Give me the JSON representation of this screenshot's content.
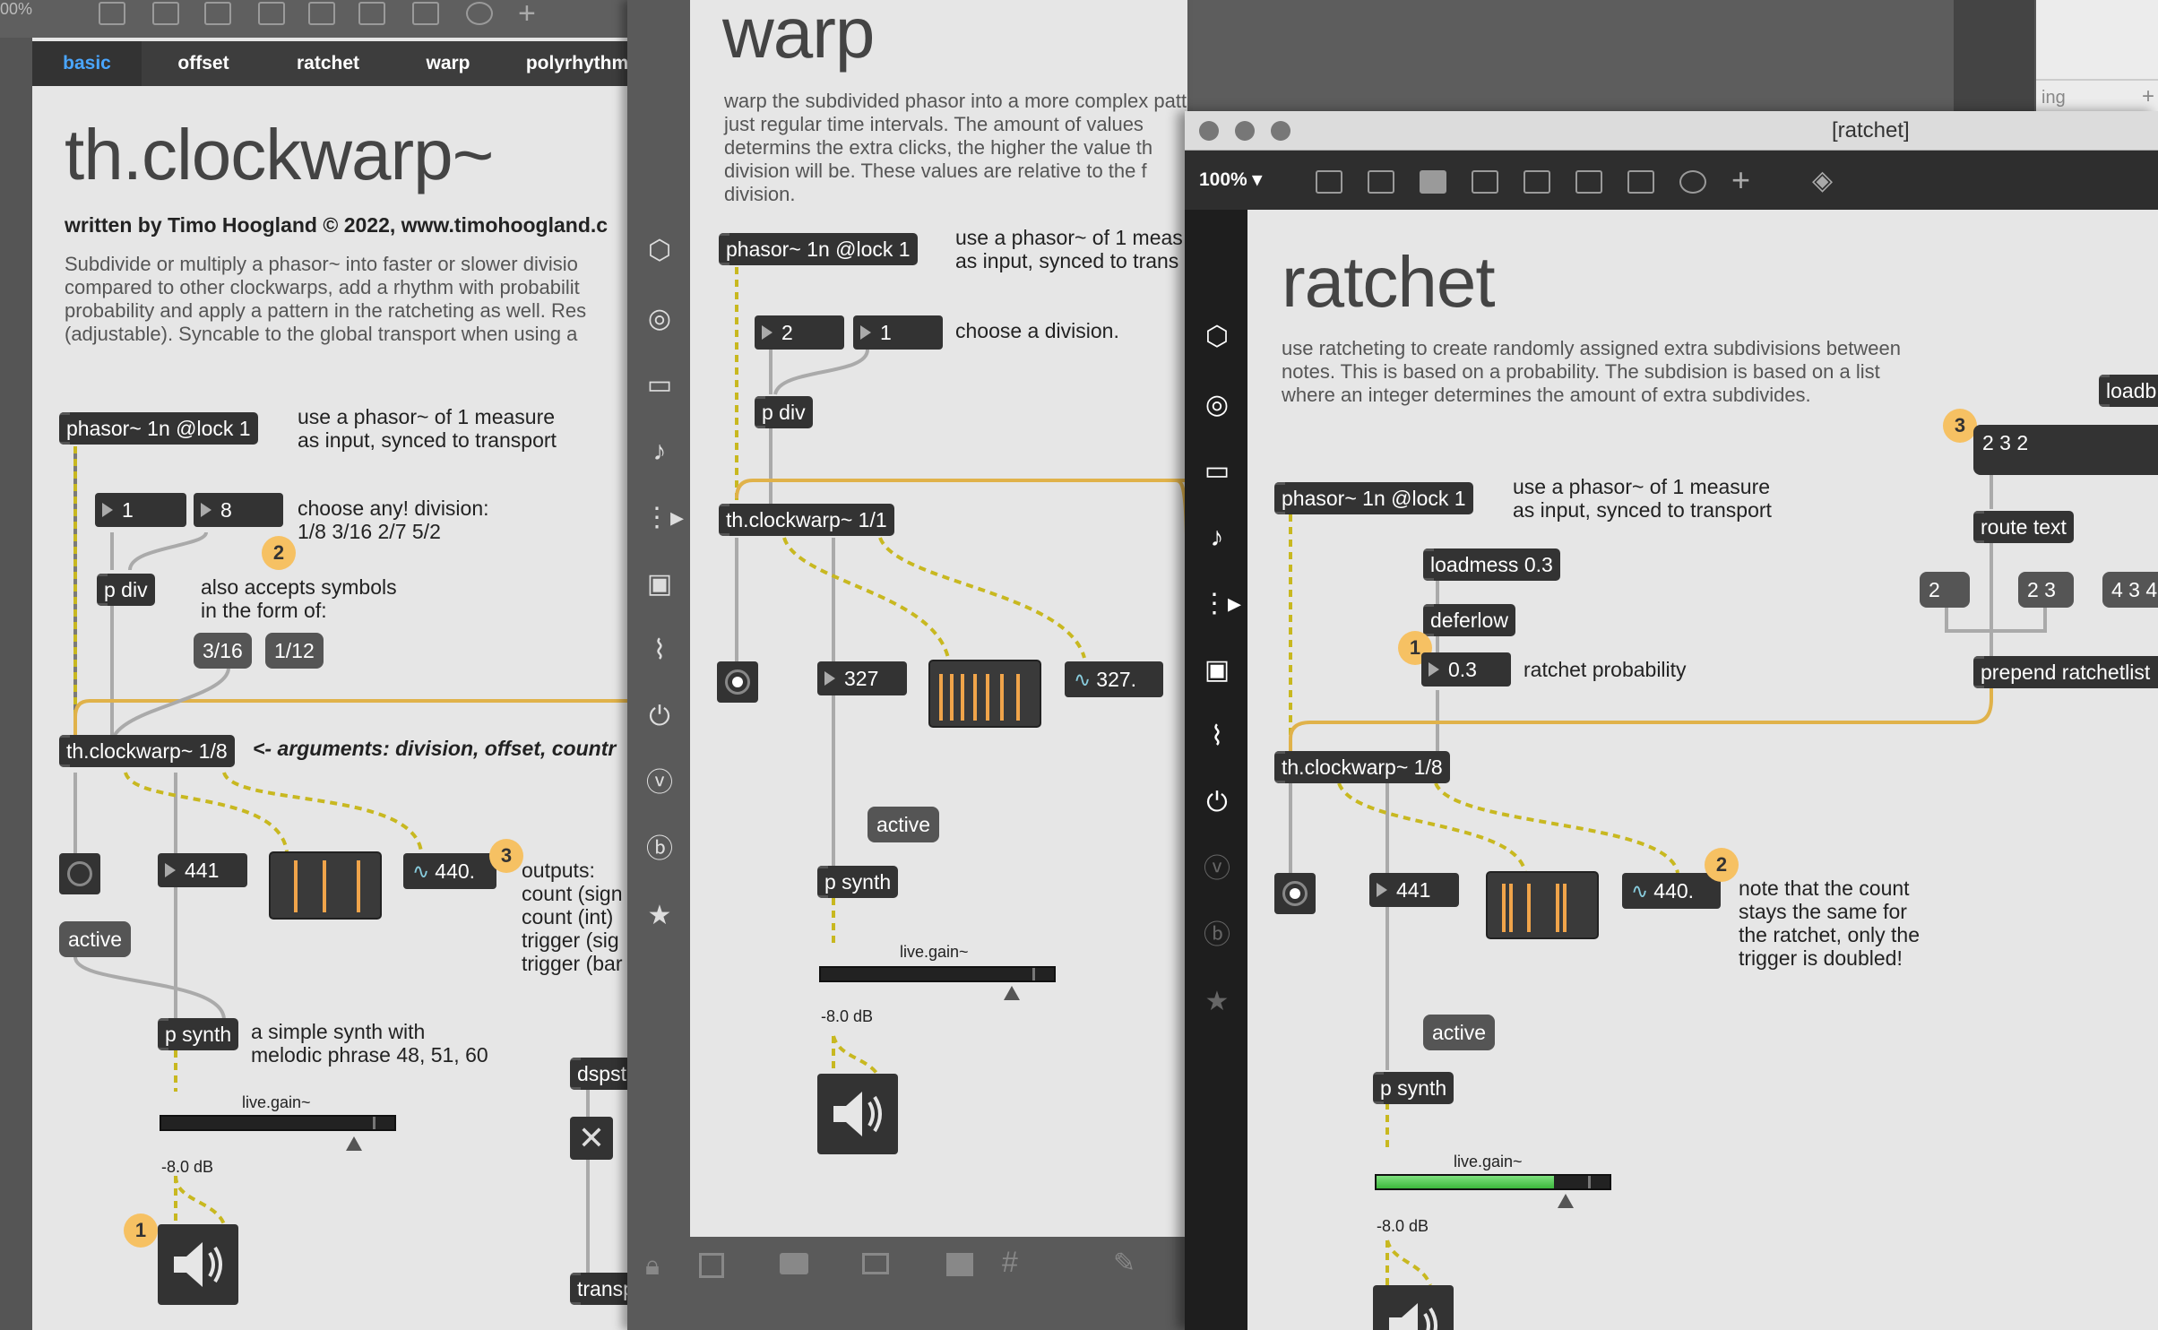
{
  "win1": {
    "zoom": "00%",
    "tabs": [
      "basic",
      "offset",
      "ratchet",
      "warp",
      "polyrhythm"
    ],
    "title": "th.clockwarp~",
    "author": "written by Timo Hoogland © 2022, www.timohoogland.c",
    "desc": "Subdivide or multiply a phasor~ into faster or slower divisio\ncompared to other clockwarps, add a rhythm with probabilit\nprobability and apply a pattern in the ratcheting as well. Res\n(adjustable). Syncable to the global transport when using a",
    "phasor": "phasor~ 1n @lock 1",
    "phasor_cmt": "use a phasor~ of 1 measure\nas input, synced to transport",
    "num_a": "1",
    "num_b": "8",
    "div_cmt": "choose any! division:\n1/8 3/16 2/7 5/2",
    "badge2": "2",
    "pdiv": "p div",
    "sym_cmt": "also accepts symbols\nin the form of:",
    "msg1": "3/16",
    "msg2": "1/12",
    "clockwarp": "th.clockwarp~ 1/8",
    "args_cmt": "<- arguments: division, offset, countr",
    "count": "441",
    "sig": "440.",
    "badge3": "3",
    "outputs_cmt": "outputs:\ncount (sign\ncount (int)\ntrigger (sig\ntrigger (bar",
    "active": "active",
    "psynth": "p synth",
    "synth_cmt": "a simple synth with\nmelodic phrase 48, 51, 60",
    "gain_label": "live.gain~",
    "gain_fill": 0.8,
    "db": "-8.0 dB",
    "badge1": "1",
    "dspst": "dspst",
    "transp": "transp"
  },
  "win2": {
    "title": "warp",
    "desc": "warp the subdivided phasor into a more complex pattern instead of\njust regular time intervals. The amount of values\ndetermins the extra clicks, the higher the value th\ndivision will be. These values are relative to the f\ndivision.",
    "phasor": "phasor~ 1n @lock 1",
    "phasor_cmt": "use a phasor~ of 1 meas\nas input, synced to trans",
    "num_a": "2",
    "num_b": "1",
    "div_cmt": "choose a division.",
    "pdiv": "p div",
    "clockwarp": "th.clockwarp~ 1/1",
    "count": "327",
    "sig": "327.",
    "active": "active",
    "psynth": "p synth",
    "gain_label": "live.gain~",
    "gain_fill": 0.8,
    "db": "-8.0 dB"
  },
  "win3": {
    "window_title": "[ratchet]",
    "zoom": "100%",
    "title": "ratchet",
    "desc": "use ratcheting to create randomly assigned extra subdivisions between\nnotes. This is based on a probability. The subdision is based on a list\nwhere an integer determines the amount of extra subdivides.",
    "phasor": "phasor~ 1n @lock 1",
    "phasor_cmt": "use a phasor~ of 1 measure\nas input, synced to transport",
    "loadmess": "loadmess 0.3",
    "deferlow": "deferlow",
    "badge1": "1",
    "prob": "0.3",
    "prob_cmt": "ratchet probability",
    "loadb": "loadb",
    "badge3": "3",
    "list_msg": "2 3 2",
    "route": "route text",
    "m1": "2",
    "m2": "2 3",
    "m3": "4 3 4",
    "prepend": "prepend ratchetlist",
    "clockwarp": "th.clockwarp~ 1/8",
    "count": "441",
    "sig": "440.",
    "badge2": "2",
    "note_cmt": "note that the count\nstays the same for\nthe ratchet, only the\ntrigger is doubled!",
    "active": "active",
    "psynth": "p synth",
    "gain_label": "live.gain~",
    "gain_level": 0.76,
    "gain_fill": 0.8,
    "db": "-8.0 dB",
    "bg_text": "ing",
    "bg_plus": "+"
  },
  "colors": {
    "accent": "#f0a44a",
    "badge": "#f6c163",
    "tab_active": "#4aa6ff",
    "patch_cord_yellow": "#c8b820",
    "meter_green": "#4ccf4c"
  }
}
